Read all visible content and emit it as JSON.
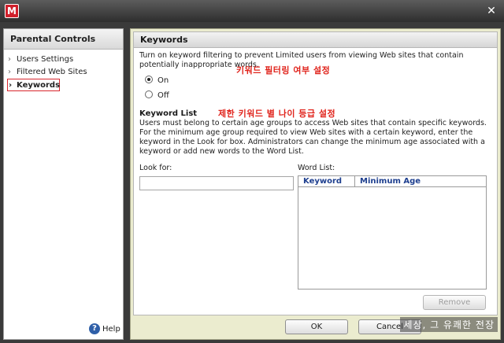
{
  "window": {
    "logo_text": "M",
    "close_glyph": "✕"
  },
  "sidebar": {
    "title": "Parental Controls",
    "items": [
      {
        "label": "Users Settings",
        "active": false
      },
      {
        "label": "Filtered Web Sites",
        "active": false
      },
      {
        "label": "Keywords",
        "active": true
      }
    ],
    "help_label": "Help",
    "help_glyph": "?"
  },
  "main": {
    "title": "Keywords",
    "description": "Turn on keyword filtering to prevent Limited users from viewing Web sites that contain potentially inappropriate words.",
    "radio_on_label": "On",
    "radio_off_label": "Off",
    "selected": "On",
    "annotation_top": "키워드 필터링 여부 설정",
    "keyword_list_title": "Keyword List",
    "annotation_mid": "제한 키워드 별 나이 등급 설정",
    "keyword_list_desc": "Users must belong to certain age groups to access Web sites that contain specific keywords. For the minimum age group required to view Web sites with a certain keyword, enter the keyword in the Look for box. Administrators can change the minimum age associated with a keyword or add new words to the Word List.",
    "look_for_label": "Look for:",
    "look_for_value": "",
    "word_list_label": "Word List:",
    "columns": [
      "Keyword",
      "Minimum Age"
    ],
    "remove_label": "Remove"
  },
  "footer": {
    "ok_label": "OK",
    "cancel_label": "Cancel"
  },
  "watermark": "세상, 그 유쾌한 전장",
  "colors": {
    "accent_red": "#d8262e",
    "header_blue": "#1e3f8f"
  }
}
